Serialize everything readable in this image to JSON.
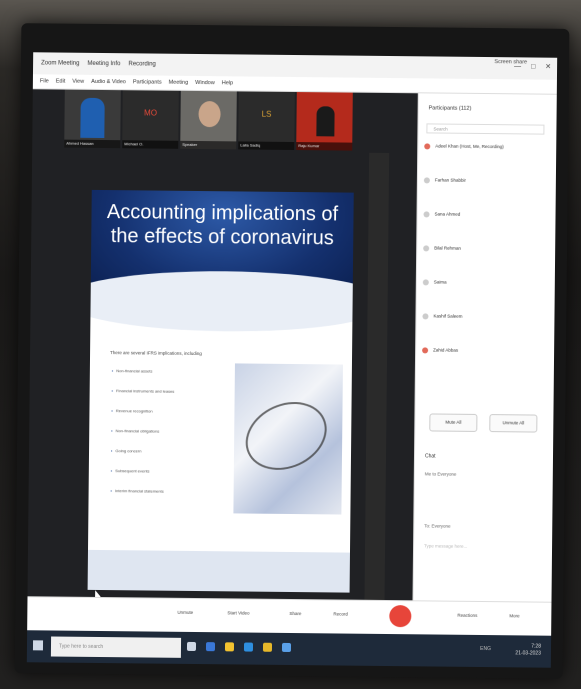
{
  "window": {
    "tabs": [
      "Zoom Meeting",
      "Meeting Info",
      "Recording"
    ],
    "present_label": "Screen share",
    "controls": [
      "—",
      "□",
      "✕"
    ]
  },
  "menu": [
    "File",
    "Edit",
    "View",
    "Audio & Video",
    "Participants",
    "Meeting",
    "Window",
    "Help"
  ],
  "video_tiles": [
    {
      "name": "Ahmed Hassan"
    },
    {
      "initials": "MO",
      "name": "Michael O."
    },
    {
      "name": "Speaker"
    },
    {
      "initials": "LS",
      "name": "Laila Sadiq"
    },
    {
      "name": "Raju Kumar"
    }
  ],
  "slide": {
    "title": "Accounting implications of the effects of coronavirus",
    "intro": "There are several IFRS implications, including",
    "bullets": [
      "Non-financial assets",
      "Financial instruments and leases",
      "Revenue recognition",
      "Non-financial obligations",
      "Going concern",
      "Subsequent events",
      "Interim financial statements"
    ]
  },
  "participants": {
    "title": "Participants (112)",
    "search_placeholder": "Search",
    "items": [
      {
        "name": "Adeel Khan (Host, Me, Recording)",
        "red": true
      },
      {
        "name": "Farhan Shabbir",
        "red": false
      },
      {
        "name": "Sana Ahmed",
        "red": false
      },
      {
        "name": "Bilal Rehman",
        "red": false
      },
      {
        "name": "Saima",
        "red": false
      },
      {
        "name": "Kashif Saleem",
        "red": false
      },
      {
        "name": "Zahid Abbas",
        "red": true
      }
    ],
    "mute_all": "Mute All",
    "more": "Unmute All"
  },
  "chat": {
    "title": "Chat",
    "message": "Me to Everyone",
    "to": "To: Everyone",
    "placeholder": "Type message here..."
  },
  "toolbar": {
    "unmute": "Unmute",
    "start_video": "Start Video",
    "share": "Share",
    "record": "Record",
    "reactions": "Reactions",
    "more": "More"
  },
  "taskbar": {
    "search_placeholder": "Type here to search",
    "time": "7:28",
    "date": "21-03-2023",
    "tray": "ENG"
  }
}
